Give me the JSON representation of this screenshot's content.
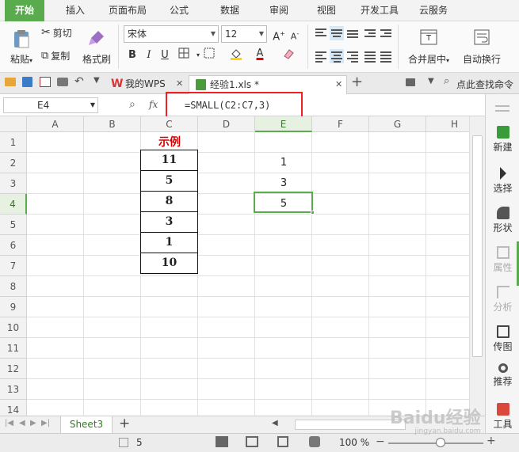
{
  "menu": {
    "tabs": [
      "开始",
      "插入",
      "页面布局",
      "公式",
      "数据",
      "审阅",
      "视图",
      "开发工具",
      "云服务"
    ],
    "active": 0
  },
  "ribbon": {
    "paste": "粘贴",
    "cut": "剪切",
    "copy": "复制",
    "format_painter": "格式刷",
    "font_name": "宋体",
    "font_size": "12",
    "bold": "B",
    "italic": "I",
    "underline": "U",
    "font_color_letter": "A",
    "merge_center": "合并居中",
    "wrap_text": "自动换行"
  },
  "doc_tabs": {
    "home": "我的WPS",
    "file": "经验1.xls *",
    "search": "点此查找命令"
  },
  "formula_bar": {
    "name_box": "E4",
    "fx": "fx",
    "formula": "=SMALL(C2:C7,3)"
  },
  "sheet": {
    "columns": [
      "A",
      "B",
      "C",
      "D",
      "E",
      "F",
      "G",
      "H"
    ],
    "rows": [
      "1",
      "2",
      "3",
      "4",
      "5",
      "6",
      "7",
      "8",
      "9",
      "10",
      "11",
      "12",
      "13",
      "14"
    ],
    "title": "示例",
    "c_values": [
      "11",
      "5",
      "8",
      "3",
      "1",
      "10"
    ],
    "e_values": [
      "1",
      "3",
      "5"
    ],
    "active_cell": "E4"
  },
  "side_panel": {
    "items": [
      "新建",
      "选择",
      "形状",
      "属性",
      "分析",
      "传图",
      "推荐",
      "工具"
    ]
  },
  "sheet_tabs": {
    "active": "Sheet3"
  },
  "status": {
    "value": "5",
    "zoom": "100 %"
  },
  "watermark": {
    "brand": "Baidu经验",
    "url": "jingyan.baidu.com"
  },
  "colors": {
    "accent": "#5aab4e",
    "highlight_red": "#e22222",
    "title_red": "#d40000"
  }
}
